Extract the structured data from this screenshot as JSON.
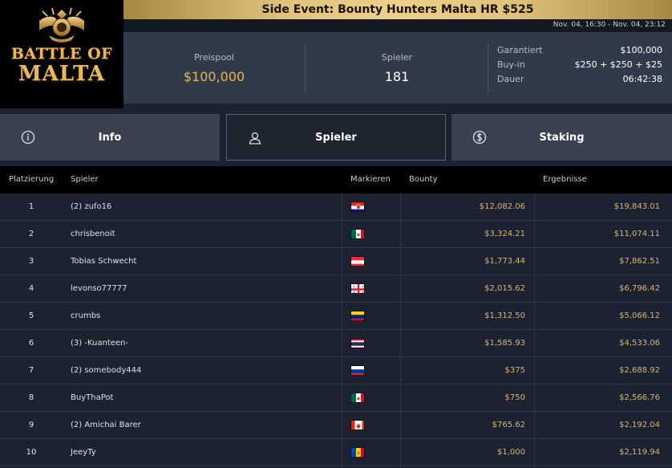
{
  "logo": {
    "line1": "BATTLE OF",
    "line2": "MALTA",
    "colors": {
      "gold": "#e8b85a"
    }
  },
  "event": {
    "title": "Side Event: Bounty Hunters Malta HR $525",
    "date_range": "Nov. 04, 16:30 - Nov. 04, 23:12"
  },
  "stats": {
    "pool_label": "Preispool",
    "pool_value": "$100,000",
    "players_label": "Spieler",
    "players_value": "181",
    "guaranteed_label": "Garantiert",
    "guaranteed_value": "$100,000",
    "buyin_label": "Buy-in",
    "buyin_value": "$250 + $250 + $25",
    "duration_label": "Dauer",
    "duration_value": "06:42:38"
  },
  "tabs": [
    {
      "label": "Info",
      "icon": "info-icon",
      "active": false
    },
    {
      "label": "Spieler",
      "icon": "user-icon",
      "active": true
    },
    {
      "label": "Staking",
      "icon": "dollar-coin-icon",
      "active": false
    }
  ],
  "table": {
    "headers": {
      "place": "Platzierung",
      "player": "Spieler",
      "flag": "Markieren",
      "bounty": "Bounty",
      "result": "Ergebnisse"
    },
    "rows": [
      {
        "place": "1",
        "player": "(2) zufo16",
        "flag": "croatia",
        "bounty": "$12,082.06",
        "result": "$19,843.01"
      },
      {
        "place": "2",
        "player": "chrisbenoit",
        "flag": "mexico",
        "bounty": "$3,324.21",
        "result": "$11,074.11"
      },
      {
        "place": "3",
        "player": "Tobias Schwecht",
        "flag": "austria",
        "bounty": "$1,773.44",
        "result": "$7,862.51"
      },
      {
        "place": "4",
        "player": "levonso77777",
        "flag": "georgia",
        "bounty": "$2,015.62",
        "result": "$6,796.42"
      },
      {
        "place": "5",
        "player": "crumbs",
        "flag": "venezuela",
        "bounty": "$1,312.50",
        "result": "$5,066.12"
      },
      {
        "place": "6",
        "player": "(3) -Kuanteen-",
        "flag": "thailand",
        "bounty": "$1,585.93",
        "result": "$4,533.06"
      },
      {
        "place": "7",
        "player": "(2) somebody444",
        "flag": "russia",
        "bounty": "$375",
        "result": "$2,688.92"
      },
      {
        "place": "8",
        "player": "BuyThaPot",
        "flag": "mexico",
        "bounty": "$750",
        "result": "$2,566.76"
      },
      {
        "place": "9",
        "player": "(2) Amichai Barer",
        "flag": "canada",
        "bounty": "$765.62",
        "result": "$2,192.04"
      },
      {
        "place": "10",
        "player": "JeeyTy",
        "flag": "moldova",
        "bounty": "$1,000",
        "result": "$2,119.94"
      }
    ]
  },
  "colors": {
    "gold_text": "#e7b352",
    "panel": "#313a49",
    "background": "#1c2230"
  }
}
